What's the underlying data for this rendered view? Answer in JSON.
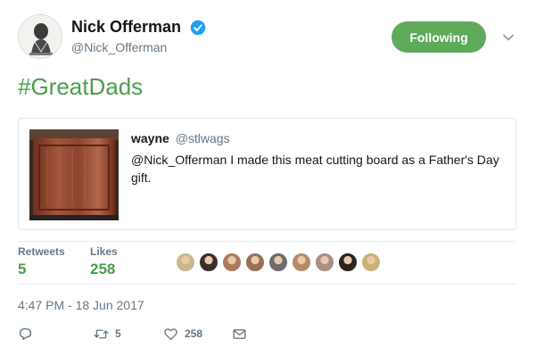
{
  "colors": {
    "accent_green": "#5eaa5a",
    "hashtag_green": "#4c9e4b",
    "verified_blue": "#1da1f2",
    "muted_text": "#657786",
    "border": "#e1e8ed"
  },
  "author": {
    "display_name": "Nick Offerman",
    "handle": "@Nick_Offerman",
    "verified": true,
    "avatar_icon": "engraved-portrait-avatar"
  },
  "follow_button": {
    "label": "Following"
  },
  "caret_icon": "chevron-down-icon",
  "tweet": {
    "text": "#GreatDads"
  },
  "quoted_tweet": {
    "name": "wayne",
    "handle": "@stlwags",
    "text": "@Nick_Offerman I made this meat cutting board as a Father's Day gift.",
    "media_description_icon": "cutting-board-photo"
  },
  "stats": {
    "retweets_label": "Retweets",
    "retweets_count": "5",
    "likes_label": "Likes",
    "likes_count": "258"
  },
  "liker_avatars": [
    "#c7b98a",
    "#3a2e2a",
    "#b07b5c",
    "#9a6e55",
    "#6c6c6c",
    "#b58a6a",
    "#a88f86",
    "#2c2420",
    "#c9b27a"
  ],
  "timestamp": "4:47 PM - 18 Jun 2017",
  "actions": {
    "reply_icon": "reply-icon",
    "retweet_icon": "retweet-icon",
    "retweet_count": "5",
    "like_icon": "heart-icon",
    "like_count": "258",
    "dm_icon": "envelope-icon"
  }
}
